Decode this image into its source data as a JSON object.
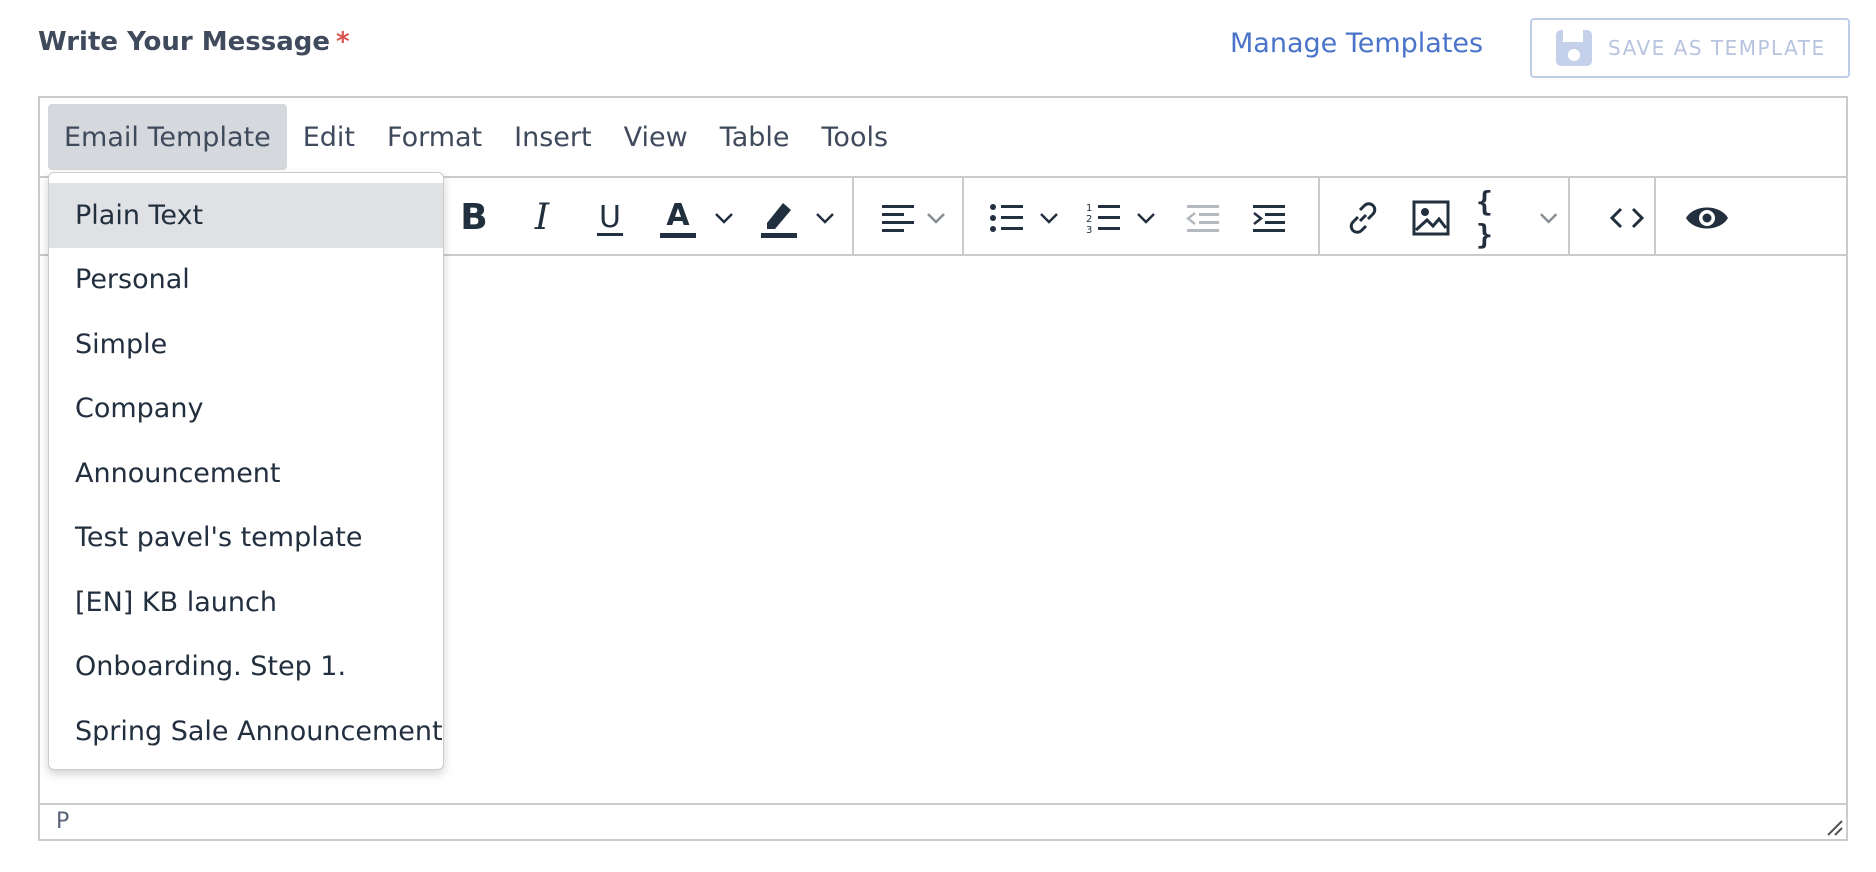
{
  "header": {
    "label": "Write Your Message",
    "required_mark": "*",
    "manage_templates": "Manage Templates",
    "save_as_template": "SAVE AS TEMPLATE"
  },
  "menubar": {
    "items": [
      "Email Template",
      "Edit",
      "Format",
      "Insert",
      "View",
      "Table",
      "Tools"
    ],
    "active": "Email Template"
  },
  "toolbar": {
    "bold": "B",
    "italic": "I",
    "underline": "U",
    "text_color": "A",
    "code_braces": "{ }",
    "icons": [
      "bold-icon",
      "italic-icon",
      "underline-icon",
      "text-color-icon",
      "highlight-icon",
      "align-left-icon",
      "bullet-list-icon",
      "numbered-list-icon",
      "outdent-icon",
      "indent-icon",
      "link-icon",
      "image-icon",
      "code-braces-icon",
      "source-code-icon",
      "preview-eye-icon"
    ]
  },
  "dropdown": {
    "items": [
      "Plain Text",
      "Personal",
      "Simple",
      "Company",
      "Announcement",
      "Test pavel's template",
      "[EN] KB launch",
      "Onboarding. Step 1.",
      "Spring Sale Announcement"
    ],
    "highlighted": "Plain Text"
  },
  "statusbar": {
    "path": "P"
  },
  "colors": {
    "link": "#4a74c9",
    "required": "#d9534f",
    "disabled_button": "#b7c3df",
    "menu_active_bg": "#d5d8dc"
  }
}
